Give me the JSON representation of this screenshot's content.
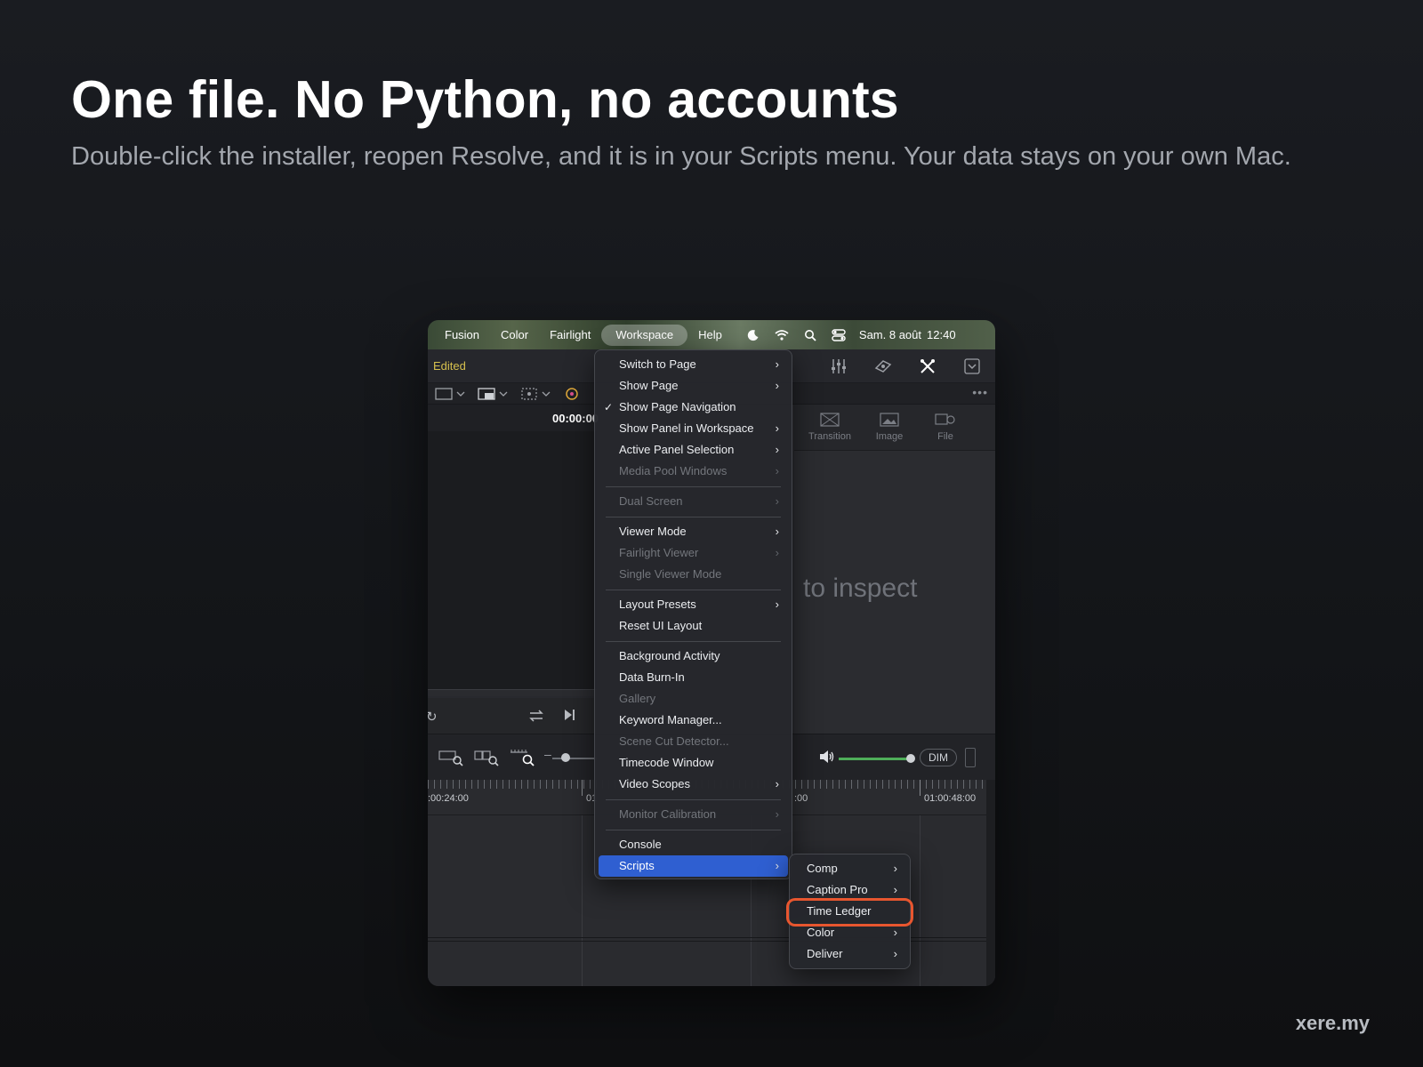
{
  "headline": "One file. No Python, no accounts",
  "subhead": "Double-click the installer, reopen Resolve, and it is in your Scripts menu. Your data stays on your own Mac.",
  "brand": "xere.my",
  "menubar": {
    "items": [
      "Fusion",
      "Color",
      "Fairlight",
      "Workspace",
      "Help"
    ],
    "active": "Workspace",
    "icons": [
      "moon-icon",
      "wifi-icon",
      "search-icon",
      "control-center-icon"
    ],
    "date": "Sam. 8 août",
    "time": "12:40"
  },
  "toolbar": {
    "status": "Edited"
  },
  "viewer": {
    "timecode": "00:00:00"
  },
  "right_panel": {
    "tabs": [
      "Transition",
      "Image",
      "File"
    ],
    "hint": "to inspect"
  },
  "audio": {
    "dim_label": "DIM"
  },
  "ruler": {
    "labels": [
      ":00:24:00",
      "01",
      ":00",
      "01:00:48:00"
    ]
  },
  "workspace_menu": {
    "groups": [
      [
        {
          "label": "Switch to Page",
          "submenu": true,
          "disabled": false,
          "checked": false
        },
        {
          "label": "Show Page",
          "submenu": true,
          "disabled": false,
          "checked": false
        },
        {
          "label": "Show Page Navigation",
          "submenu": false,
          "disabled": false,
          "checked": true
        },
        {
          "label": "Show Panel in Workspace",
          "submenu": true,
          "disabled": false,
          "checked": false
        },
        {
          "label": "Active Panel Selection",
          "submenu": true,
          "disabled": false,
          "checked": false
        },
        {
          "label": "Media Pool Windows",
          "submenu": true,
          "disabled": true,
          "checked": false
        }
      ],
      [
        {
          "label": "Dual Screen",
          "submenu": true,
          "disabled": true,
          "checked": false
        }
      ],
      [
        {
          "label": "Viewer Mode",
          "submenu": true,
          "disabled": false,
          "checked": false
        },
        {
          "label": "Fairlight Viewer",
          "submenu": true,
          "disabled": true,
          "checked": false
        },
        {
          "label": "Single Viewer Mode",
          "submenu": false,
          "disabled": true,
          "checked": false
        }
      ],
      [
        {
          "label": "Layout Presets",
          "submenu": true,
          "disabled": false,
          "checked": false
        },
        {
          "label": "Reset UI Layout",
          "submenu": false,
          "disabled": false,
          "checked": false
        }
      ],
      [
        {
          "label": "Background Activity",
          "submenu": false,
          "disabled": false,
          "checked": false
        },
        {
          "label": "Data Burn-In",
          "submenu": false,
          "disabled": false,
          "checked": false
        },
        {
          "label": "Gallery",
          "submenu": false,
          "disabled": true,
          "checked": false
        },
        {
          "label": "Keyword Manager...",
          "submenu": false,
          "disabled": false,
          "checked": false
        },
        {
          "label": "Scene Cut Detector...",
          "submenu": false,
          "disabled": true,
          "checked": false
        },
        {
          "label": "Timecode Window",
          "submenu": false,
          "disabled": false,
          "checked": false
        },
        {
          "label": "Video Scopes",
          "submenu": true,
          "disabled": false,
          "checked": false
        }
      ],
      [
        {
          "label": "Monitor Calibration",
          "submenu": true,
          "disabled": true,
          "checked": false
        }
      ],
      [
        {
          "label": "Console",
          "submenu": false,
          "disabled": false,
          "checked": false
        },
        {
          "label": "Scripts",
          "submenu": true,
          "disabled": false,
          "checked": false,
          "selected": true
        }
      ]
    ]
  },
  "scripts_submenu": {
    "items": [
      {
        "label": "Comp",
        "submenu": true
      },
      {
        "label": "Caption Pro",
        "submenu": true
      },
      {
        "label": "Time Ledger",
        "submenu": false,
        "highlighted": true
      },
      {
        "label": "Color",
        "submenu": true
      },
      {
        "label": "Deliver",
        "submenu": true
      }
    ]
  },
  "colors": {
    "background": "#131518",
    "menu_selected": "#2f5fd1",
    "highlight_ring": "#e8562f",
    "edited": "#d6c04e"
  }
}
